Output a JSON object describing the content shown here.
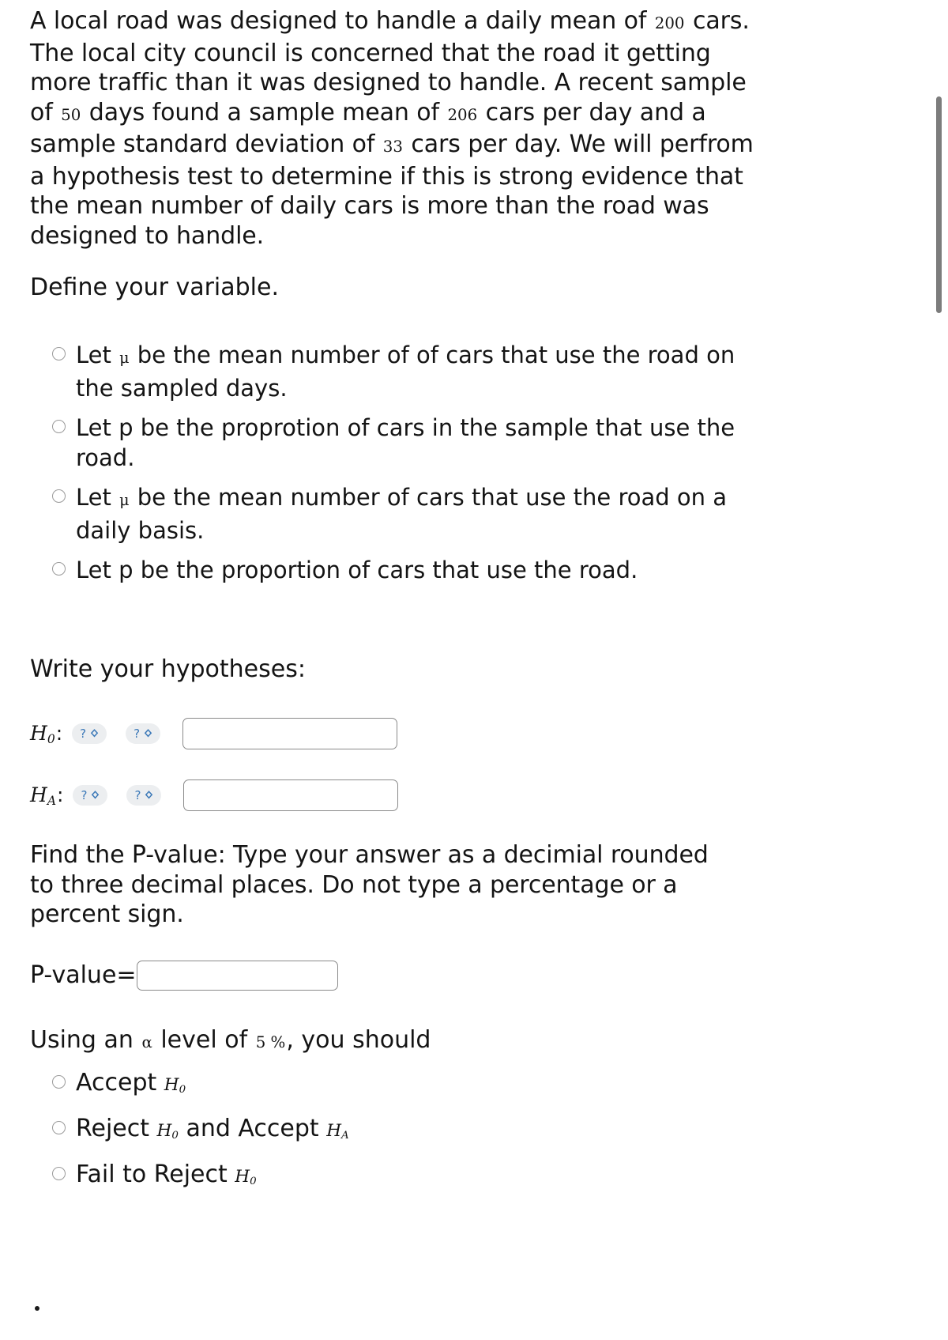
{
  "problem": {
    "text_parts": [
      {
        "t": "A local road was designed to handle a daily mean of ",
        "k": "plain"
      },
      {
        "t": "200",
        "k": "math"
      },
      {
        "t": " cars. The local city council is concerned that the road it getting more traffic than it was designed to handle. A recent sample of ",
        "k": "plain"
      },
      {
        "t": "50",
        "k": "math"
      },
      {
        "t": " days found a sample mean of ",
        "k": "plain"
      },
      {
        "t": "206",
        "k": "math"
      },
      {
        "t": " cars per day and a sample standard deviation of ",
        "k": "plain"
      },
      {
        "t": "33",
        "k": "math"
      },
      {
        "t": " cars per day. We will perfrom a hypothesis test to determine if this is strong evidence that the mean number of daily cars is more than the road was designed to handle.",
        "k": "plain"
      }
    ],
    "daily_mean_design": "200",
    "sample_size": "50",
    "sample_mean": "206",
    "sample_sd": "33"
  },
  "define_variable": {
    "heading": "Define your variable.",
    "options": [
      {
        "parts": [
          {
            "t": "Let ",
            "k": "plain"
          },
          {
            "t": "μ",
            "k": "math"
          },
          {
            "t": " be the mean number of of cars that use the road on the sampled days.",
            "k": "plain"
          }
        ],
        "plain": "Let μ be the mean number of of cars that use the road on the sampled days."
      },
      {
        "parts": [
          {
            "t": "Let p be the proprotion of cars in the sample that use the road.",
            "k": "plain"
          }
        ],
        "plain": "Let p be the proprotion of cars in the sample that use the road."
      },
      {
        "parts": [
          {
            "t": "Let ",
            "k": "plain"
          },
          {
            "t": "μ",
            "k": "math"
          },
          {
            "t": " be the mean number of cars that use the road on a daily basis.",
            "k": "plain"
          }
        ],
        "plain": "Let μ be the mean number of cars that use the road on a daily basis."
      },
      {
        "parts": [
          {
            "t": "Let p be the proportion of cars that use the road.",
            "k": "plain"
          }
        ],
        "plain": "Let p be the proportion of cars that use the road."
      }
    ]
  },
  "hypotheses": {
    "heading": "Write your hypotheses:",
    "rows": [
      {
        "symbol": "H",
        "subscript": "0",
        "colon": ":",
        "dropdown1": {
          "label": "?",
          "icon": "chevron-updown-icon",
          "value": ""
        },
        "dropdown2": {
          "label": "?",
          "icon": "chevron-updown-icon",
          "value": ""
        },
        "input_value": "",
        "input_placeholder": ""
      },
      {
        "symbol": "H",
        "subscript": "A",
        "colon": ":",
        "dropdown1": {
          "label": "?",
          "icon": "chevron-updown-icon",
          "value": ""
        },
        "dropdown2": {
          "label": "?",
          "icon": "chevron-updown-icon",
          "value": ""
        },
        "input_value": "",
        "input_placeholder": ""
      }
    ]
  },
  "pvalue": {
    "instructions": "Find the P-value: Type your answer as a decimial rounded to three decimal places. Do not type a percentage or a percent sign.",
    "label": "P-value=",
    "input_value": "",
    "input_placeholder": ""
  },
  "conclusion": {
    "prompt_parts": [
      {
        "t": "Using an ",
        "k": "plain"
      },
      {
        "t": "α",
        "k": "math"
      },
      {
        "t": " level of ",
        "k": "plain"
      },
      {
        "t": "5 %",
        "k": "math"
      },
      {
        "t": ", you should",
        "k": "plain"
      }
    ],
    "alpha_symbol": "α",
    "alpha_level": "5 %",
    "options": [
      {
        "parts": [
          {
            "t": "Accept ",
            "k": "plain"
          },
          {
            "t": "H",
            "k": "mathH",
            "sub": "0"
          }
        ],
        "plain": "Accept H0"
      },
      {
        "parts": [
          {
            "t": "Reject ",
            "k": "plain"
          },
          {
            "t": "H",
            "k": "mathH",
            "sub": "0"
          },
          {
            "t": " and Accept ",
            "k": "plain"
          },
          {
            "t": "H",
            "k": "mathH",
            "sub": "A"
          }
        ],
        "plain": "Reject H0 and Accept HA"
      },
      {
        "parts": [
          {
            "t": "Fail to Reject ",
            "k": "plain"
          },
          {
            "t": "H",
            "k": "mathH",
            "sub": "0"
          }
        ],
        "plain": "Fail to Reject H0"
      }
    ]
  },
  "scrollbar": {
    "orientation": "vertical",
    "thumb_color": "#7c7c7c"
  },
  "colors": {
    "text": "#141414",
    "accent": "#3c79b8",
    "dropdown_bg": "#eceef0",
    "input_border": "#8a8a8a",
    "radio_border": "#9a9a9a"
  }
}
